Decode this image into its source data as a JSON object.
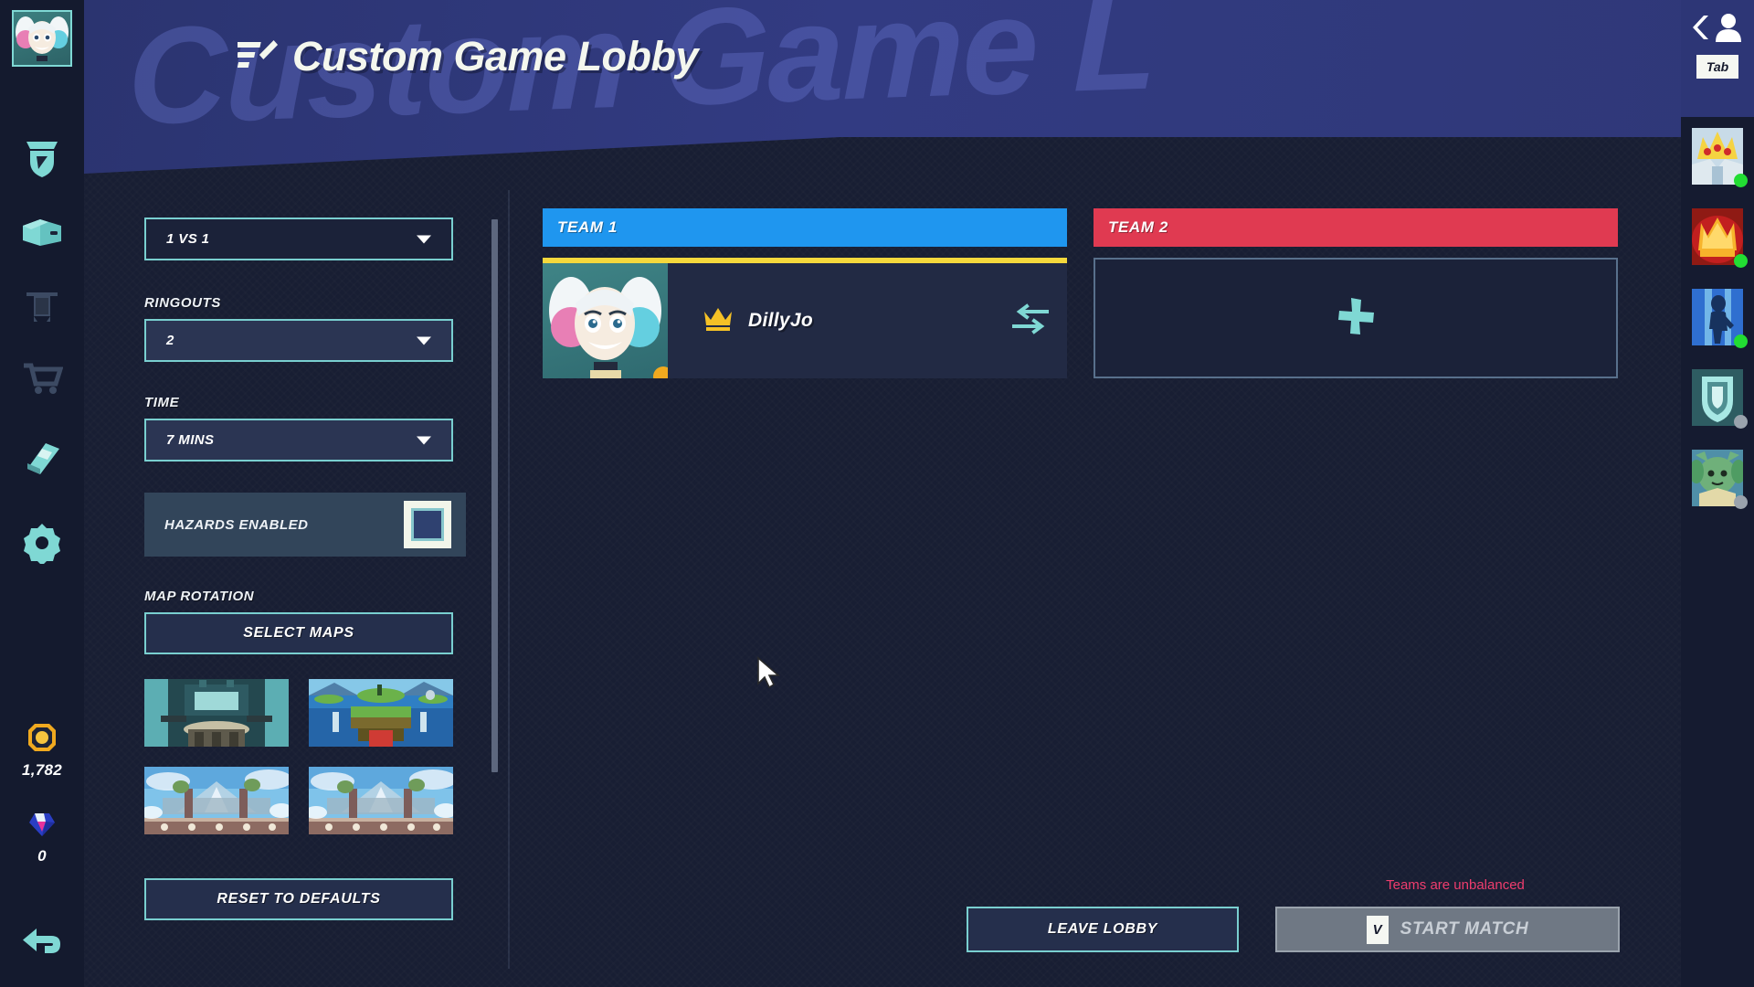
{
  "header": {
    "title": "Custom Game Lobby",
    "watermark": "Custom Game L",
    "edit_icon": "edit-pencil-icon"
  },
  "left_rail": {
    "avatar_name": "player-avatar",
    "icons": [
      {
        "name": "ranked-shield-icon",
        "dim": false
      },
      {
        "name": "loot-box-icon",
        "dim": false
      },
      {
        "name": "banner-flag-icon",
        "dim": true
      },
      {
        "name": "shop-cart-icon",
        "dim": true
      },
      {
        "name": "legends-book-icon",
        "dim": false
      },
      {
        "name": "settings-gear-icon",
        "dim": false
      }
    ],
    "currencies": [
      {
        "icon": "gold-coin-icon",
        "amount": "1,782",
        "color": "#f0a91f"
      },
      {
        "icon": "mammoth-gem-icon",
        "amount": "0",
        "color": "#3b53c8"
      }
    ],
    "back_icon": "back-arrow-icon"
  },
  "settings": {
    "game_mode": {
      "label": "",
      "value": "1 VS 1"
    },
    "ringouts": {
      "label": "RINGOUTS",
      "value": "2"
    },
    "time": {
      "label": "TIME",
      "value": "7 MINS"
    },
    "hazards": {
      "label": "HAZARDS ENABLED",
      "checked": false
    },
    "map_rotation": {
      "label": "MAP ROTATION",
      "select_maps_label": "SELECT MAPS",
      "maps": [
        {
          "name": "map-thumb-temple",
          "palette": [
            "#6fd0d4",
            "#2a4f56",
            "#9fd9d8"
          ]
        },
        {
          "name": "map-thumb-island",
          "palette": [
            "#2f7fc4",
            "#6bb24a",
            "#cf3b34"
          ]
        },
        {
          "name": "map-thumb-skyfall-a",
          "palette": [
            "#7fc3ea",
            "#e8eef5",
            "#7d5d5a"
          ]
        },
        {
          "name": "map-thumb-skyfall-b",
          "palette": [
            "#7fc3ea",
            "#e8eef5",
            "#7d5d5a"
          ]
        }
      ]
    },
    "reset_label": "RESET TO DEFAULTS"
  },
  "teams": {
    "team1": {
      "label": "TEAM 1",
      "color": "#1f96ef",
      "players": [
        {
          "name": "DillyJo",
          "is_host": true,
          "host_icon": "crown-icon",
          "swap_icon": "swap-arrows-icon",
          "status": "ready",
          "status_color": "#f0a91f"
        }
      ]
    },
    "team2": {
      "label": "TEAM 2",
      "color": "#e03a51",
      "players": [],
      "add_icon": "plus-icon"
    }
  },
  "bottom": {
    "warning": "Teams are unbalanced",
    "warning_color": "#ef3d6e",
    "leave_label": "LEAVE LOBBY",
    "start_label": "START MATCH",
    "start_key": "V",
    "start_disabled": true
  },
  "right_rail": {
    "collapse_icon": "chevron-left-icon",
    "friends_icon": "person-icon",
    "tab_key": "Tab",
    "friends": [
      {
        "name": "friend-avatar-1",
        "status": "online",
        "dot": "#22dd33",
        "palette": [
          "#f5d342",
          "#cf2b2b",
          "#dfe9ef"
        ]
      },
      {
        "name": "friend-avatar-2",
        "status": "online",
        "dot": "#22dd33",
        "palette": [
          "#f7b32b",
          "#c21f1f",
          "#ffd96b"
        ]
      },
      {
        "name": "friend-avatar-3",
        "status": "online",
        "dot": "#22dd33",
        "palette": [
          "#2f6fd0",
          "#8fd4f2",
          "#17325e"
        ]
      },
      {
        "name": "friend-avatar-4",
        "status": "offline",
        "dot": "#9aa3ad",
        "palette": [
          "#a8e8e4",
          "#4f8f92",
          "#d8f4f2"
        ]
      },
      {
        "name": "friend-avatar-5",
        "status": "offline",
        "dot": "#9aa3ad",
        "palette": [
          "#4f9c63",
          "#8fd3a0",
          "#e3d9a8"
        ]
      }
    ]
  }
}
